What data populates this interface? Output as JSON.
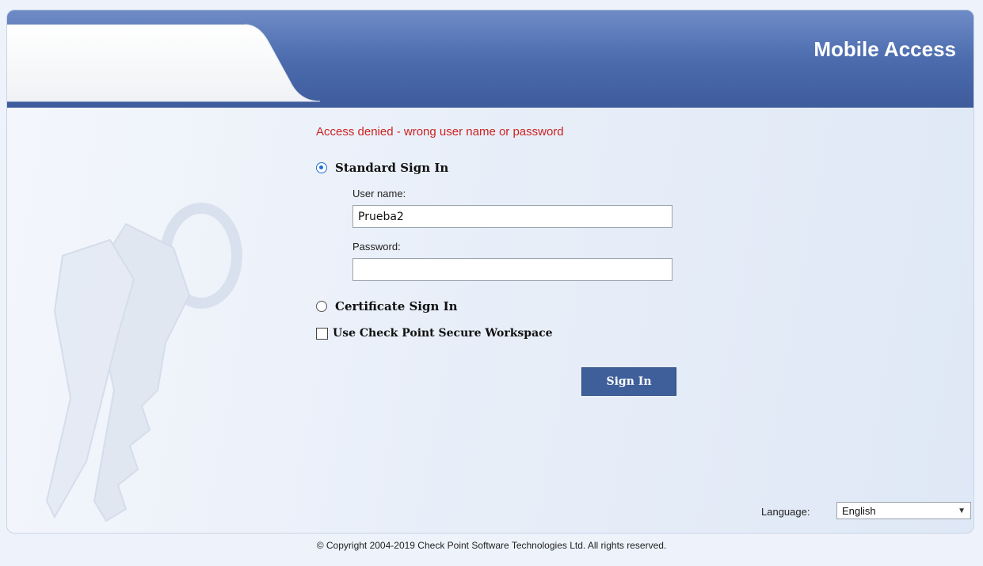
{
  "header": {
    "brand": "Mobile Access",
    "colors": {
      "banner": "#4a6aa8",
      "banner_light": "#6a88c0"
    }
  },
  "form": {
    "error_message": "Access denied - wrong user name or password",
    "standard_sign_in": {
      "label": "Standard Sign In",
      "selected": true
    },
    "username": {
      "label": "User name:",
      "value": "Prueba2"
    },
    "password": {
      "label": "Password:",
      "value": ""
    },
    "certificate_sign_in": {
      "label": "Certificate Sign In",
      "selected": false
    },
    "secure_workspace": {
      "label": "Use Check Point Secure Workspace",
      "checked": false
    },
    "sign_in_button": "Sign In"
  },
  "language": {
    "label": "Language:",
    "selected": "English"
  },
  "footer": {
    "copyright": "© Copyright 2004-2019   Check Point Software Technologies Ltd. All rights reserved."
  }
}
